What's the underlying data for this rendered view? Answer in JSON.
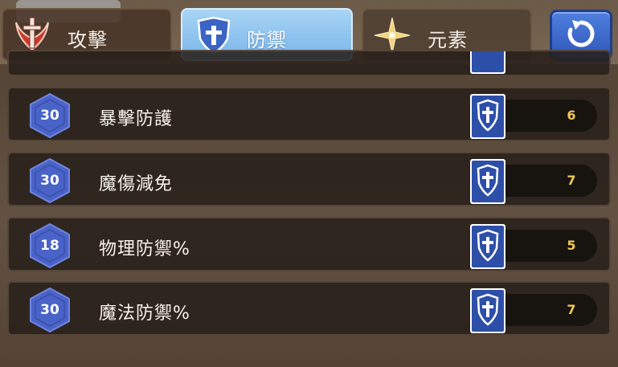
{
  "tabs": {
    "attack": {
      "label": "攻擊"
    },
    "defense": {
      "label": "防禦"
    },
    "element": {
      "label": "元素"
    }
  },
  "refresh": {
    "icon": "refresh-icon"
  },
  "rows": [
    {
      "level": "30",
      "label": "暴擊防護",
      "value": "6",
      "icon": "shield-icon"
    },
    {
      "level": "30",
      "label": "魔傷減免",
      "value": "7",
      "icon": "shield-icon"
    },
    {
      "level": "18",
      "label": "物理防禦%",
      "value": "5",
      "icon": "shield-icon"
    },
    {
      "level": "30",
      "label": "魔法防禦%",
      "value": "7",
      "icon": "shield-icon"
    }
  ],
  "colors": {
    "active_tab": "#8fc4f0",
    "badge": "#4a63c8",
    "value": "#f2c75a",
    "shield_bg": "#2d4fa8"
  }
}
